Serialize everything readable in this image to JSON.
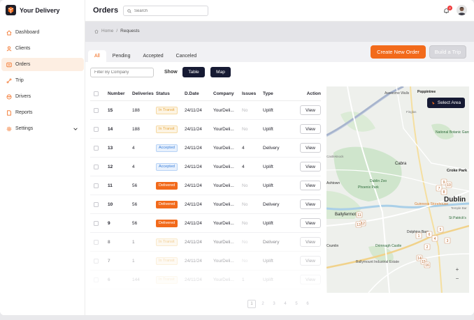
{
  "brand": {
    "name": "Your Delivery"
  },
  "sidebar": {
    "items": [
      {
        "label": "Dashboard",
        "icon": "home-icon"
      },
      {
        "label": "Clients",
        "icon": "user-icon"
      },
      {
        "label": "Orders",
        "icon": "list-icon",
        "active": true
      },
      {
        "label": "Trip",
        "icon": "route-icon"
      },
      {
        "label": "Drivers",
        "icon": "steering-wheel-icon"
      },
      {
        "label": "Reports",
        "icon": "document-icon"
      },
      {
        "label": "Settings",
        "icon": "gear-icon"
      }
    ]
  },
  "header": {
    "title": "Orders",
    "search_placeholder": "Search",
    "notification_count": "2"
  },
  "breadcrumb": {
    "home": "Home",
    "separator": "/",
    "current": "Requests"
  },
  "tabs": [
    "All",
    "Pending",
    "Accepted",
    "Canceled"
  ],
  "actions": {
    "create": "Create New Order",
    "build_trip": "Build a Trip"
  },
  "filters": {
    "company_placeholder": "Filter By Company",
    "show_label": "Show",
    "table_btn": "Table",
    "map_btn": "Map"
  },
  "table": {
    "columns": [
      "Number",
      "Deliveries",
      "Status",
      "D.Date",
      "Company",
      "Issues",
      "Type",
      "Action"
    ],
    "rows": [
      {
        "number": "15",
        "deliveries": "188",
        "status": "In Transit",
        "date": "24/11/24",
        "company": "YourDeli...",
        "issues": "No",
        "type": "Uplift",
        "action": "View"
      },
      {
        "number": "14",
        "deliveries": "188",
        "status": "In Transit",
        "date": "24/11/24",
        "company": "YourDeli...",
        "issues": "No",
        "type": "Uplift",
        "action": "View"
      },
      {
        "number": "13",
        "deliveries": "4",
        "status": "Accepted",
        "date": "24/11/24",
        "company": "YourDeli...",
        "issues": "4",
        "type": "Delivery",
        "action": "View"
      },
      {
        "number": "12",
        "deliveries": "4",
        "status": "Accepted",
        "date": "24/11/24",
        "company": "YourDeli...",
        "issues": "4",
        "type": "Uplift",
        "action": "View"
      },
      {
        "number": "11",
        "deliveries": "56",
        "status": "Delivered",
        "date": "24/11/24",
        "company": "YourDeli...",
        "issues": "No",
        "type": "Uplift",
        "action": "View"
      },
      {
        "number": "10",
        "deliveries": "56",
        "status": "Delivered",
        "date": "24/11/24",
        "company": "YourDeli...",
        "issues": "No",
        "type": "Delivery",
        "action": "View"
      },
      {
        "number": "9",
        "deliveries": "56",
        "status": "Delivered",
        "date": "24/11/24",
        "company": "YourDeli...",
        "issues": "No",
        "type": "Uplift",
        "action": "View"
      },
      {
        "number": "8",
        "deliveries": "1",
        "status": "In Transit",
        "date": "24/11/24",
        "company": "YourDeli...",
        "issues": "No",
        "type": "Delivery",
        "action": "View"
      },
      {
        "number": "7",
        "deliveries": "1",
        "status": "In Transit",
        "date": "24/11/24",
        "company": "YourDeli...",
        "issues": "No",
        "type": "Uplift",
        "action": "View"
      },
      {
        "number": "6",
        "deliveries": "144",
        "status": "In Transit",
        "date": "24/11/24",
        "company": "YourDeli...",
        "issues": "1",
        "type": "Uplift",
        "action": "View"
      }
    ]
  },
  "map": {
    "select_area": "Select Area",
    "labels": [
      "Awesome Walls",
      "Poppintree",
      "Cabra",
      "Dublin",
      "Phoenix Park",
      "Dublin Zoo",
      "National Botanic Gardens",
      "Guinness Storehouse",
      "Ballyfermot",
      "Drimnagh Castle",
      "Ballymount Industrial Estate",
      "Crumlin",
      "Croke Park",
      "St Patrick's",
      "Finglas",
      "Castleknock",
      "Temple Bar",
      "Dolphins Barn",
      "Ashtown"
    ],
    "markers": [
      "9",
      "7",
      "8",
      "10",
      "11",
      "12",
      "13",
      "5",
      "6",
      "4",
      "3",
      "2",
      "1",
      "14",
      "15",
      "16"
    ]
  },
  "pagination": [
    "1",
    "2",
    "3",
    "4",
    "5",
    "6"
  ],
  "colors": {
    "accent": "#f26a1b",
    "navy": "#161a33",
    "transit": "#e6a53a",
    "accepted": "#3a7fd9"
  }
}
